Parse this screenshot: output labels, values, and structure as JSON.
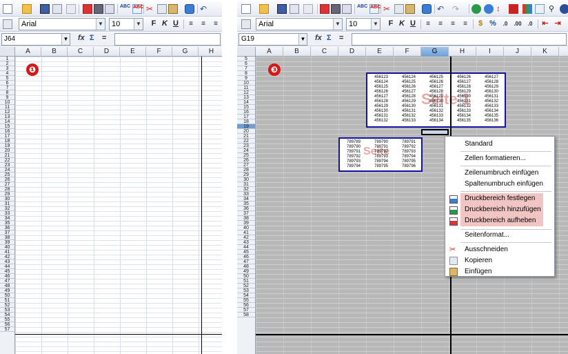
{
  "left": {
    "font_name": "Arial",
    "font_size": "10",
    "name_box": "J64",
    "formula_icons": [
      "fx",
      "Σ",
      "="
    ],
    "columns": [
      "A",
      "B",
      "C",
      "D",
      "E",
      "F",
      "G",
      "H"
    ],
    "rows_start": 1,
    "rows_end": 57,
    "marker": "❶"
  },
  "right": {
    "font_name": "Arial",
    "font_size": "10",
    "name_box": "G19",
    "formula_icons": [
      "fx",
      "Σ",
      "="
    ],
    "columns": [
      "A",
      "B",
      "C",
      "D",
      "E",
      "F",
      "G",
      "H",
      "I",
      "J",
      "K"
    ],
    "selected_column": "G",
    "rows_start": 5,
    "rows_end": 58,
    "selected_row": 19,
    "marker": "❸",
    "page1_label": "Seite 1",
    "page2_label": "Seite",
    "block1": [
      [
        "456123",
        "456124",
        "456125",
        "456126",
        "456127"
      ],
      [
        "456124",
        "456125",
        "456126",
        "456127",
        "456128"
      ],
      [
        "456125",
        "456126",
        "456127",
        "456128",
        "456129"
      ],
      [
        "456126",
        "456127",
        "456128",
        "456129",
        "456130"
      ],
      [
        "456127",
        "456128",
        "456129",
        "456130",
        "456131"
      ],
      [
        "456128",
        "456129",
        "456130",
        "456131",
        "456132"
      ],
      [
        "456129",
        "456130",
        "456131",
        "456132",
        "456133"
      ],
      [
        "456130",
        "456131",
        "456132",
        "456133",
        "456134"
      ],
      [
        "456131",
        "456132",
        "456133",
        "456134",
        "456135"
      ],
      [
        "456132",
        "456133",
        "456134",
        "456135",
        "456136"
      ]
    ],
    "block2": [
      [
        "789789",
        "789790",
        "789791"
      ],
      [
        "789790",
        "789791",
        "789792"
      ],
      [
        "789791",
        "789792",
        "789793"
      ],
      [
        "789792",
        "789793",
        "789794"
      ],
      [
        "789793",
        "789794",
        "789795"
      ],
      [
        "789794",
        "789795",
        "789796"
      ]
    ],
    "context_menu": {
      "standard": "Standard",
      "format_cells": "Zellen formatieren...",
      "row_break": "Zeilenumbruch einfügen",
      "col_break": "Spaltenumbruch einfügen",
      "set_print_range": "Druckbereich festlegen",
      "add_print_range": "Druckbereich hinzufügen",
      "remove_print_range": "Druckbereich aufheben",
      "page_format": "Seitenformat...",
      "cut": "Ausschneiden",
      "copy": "Kopieren",
      "paste": "Einfügen"
    }
  },
  "colors": {
    "highlight": "#f2c5c5",
    "print_border": "#1414a0",
    "marker": "#d11a1a",
    "selection": "#6d9fd6"
  }
}
